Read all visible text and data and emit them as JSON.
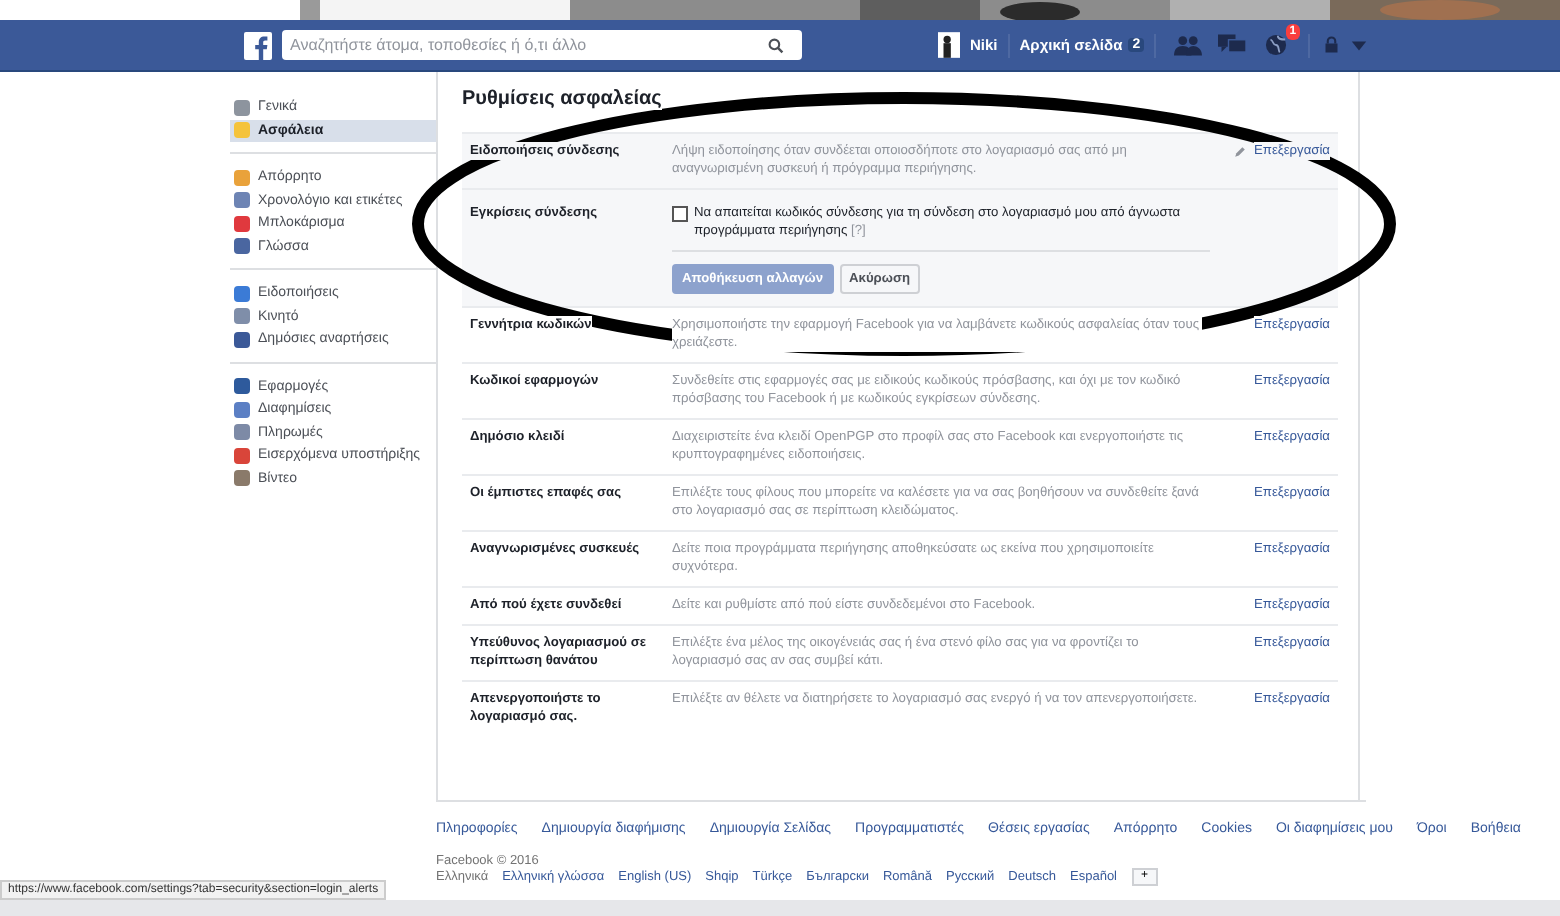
{
  "topbar": {
    "search": {
      "placeholder": "Αναζητήστε άτομα, τοποθεσίες ή ό,τι άλλο"
    },
    "user": "Niki",
    "home": {
      "label": "Αρχική σελίδα",
      "count": "2"
    },
    "notifications_badge": "1"
  },
  "sidebar": {
    "groups": [
      [
        {
          "label": "Γενικά",
          "color": "#8d949e",
          "selected": false
        },
        {
          "label": "Ασφάλεια",
          "color": "#f5c33b",
          "selected": true
        }
      ],
      [
        {
          "label": "Απόρρητο",
          "color": "#e9a23b",
          "selected": false
        },
        {
          "label": "Χρονολόγιο και ετικέτες",
          "color": "#6d84b4",
          "selected": false
        },
        {
          "label": "Μπλοκάρισμα",
          "color": "#e0393e",
          "selected": false
        },
        {
          "label": "Γλώσσα",
          "color": "#4a66a0",
          "selected": false
        }
      ],
      [
        {
          "label": "Ειδοποιήσεις",
          "color": "#3b7bd6",
          "selected": false
        },
        {
          "label": "Κινητό",
          "color": "#7f8ea9",
          "selected": false
        },
        {
          "label": "Δημόσιες αναρτήσεις",
          "color": "#3b5998",
          "selected": false
        }
      ],
      [
        {
          "label": "Εφαρμογές",
          "color": "#2e5a9c",
          "selected": false
        },
        {
          "label": "Διαφημίσεις",
          "color": "#5b7fc4",
          "selected": false
        },
        {
          "label": "Πληρωμές",
          "color": "#7d8aa6",
          "selected": false
        },
        {
          "label": "Εισερχόμενα υποστήριξης",
          "color": "#d9453a",
          "selected": false
        },
        {
          "label": "Βίντεο",
          "color": "#8a7a6a",
          "selected": false
        }
      ]
    ]
  },
  "settings": {
    "title": "Ρυθμίσεις ασφαλείας",
    "rows": [
      {
        "kind": "summary",
        "label": "Ειδοποιήσεις σύνδεσης",
        "description": "Λήψη ειδοποίησης όταν συνδέεται οποιοσδήποτε στο λογαριασμό σας από μη αναγνωρισμένη συσκευή ή πρόγραμμα περιήγησης.",
        "action": "Επεξεργασία",
        "hovered": true
      },
      {
        "kind": "editor",
        "label": "Εγκρίσεις σύνδεσης",
        "option": "Να απαιτείται κωδικός σύνδεσης για τη σύνδεση στο λογαριασμό μου από άγνωστα προγράμματα περιήγησης",
        "help": "[?]",
        "checked": false,
        "buttons": [
          "Αποθήκευση αλλαγών",
          "Ακύρωση"
        ]
      },
      {
        "kind": "summary",
        "label": "Γεννήτρια κωδικών",
        "description": "Χρησιμοποιήστε την εφαρμογή Facebook για να λαμβάνετε κωδικούς ασφαλείας όταν τους χρειάζεστε.",
        "action": "Επεξεργασία",
        "hovered": false
      },
      {
        "kind": "summary",
        "label": "Κωδικοί εφαρμογών",
        "description": "Συνδεθείτε στις εφαρμογές σας με ειδικούς κωδικούς πρόσβασης, και όχι με τον κωδικό πρόσβασης του Facebook ή με κωδικούς εγκρίσεων σύνδεσης.",
        "action": "Επεξεργασία",
        "hovered": false
      },
      {
        "kind": "summary",
        "label": "Δημόσιο κλειδί",
        "description": "Διαχειριστείτε ένα κλειδί OpenPGP στο προφίλ σας στο Facebook και ενεργοποιήστε τις κρυπτογραφημένες ειδοποιήσεις.",
        "action": "Επεξεργασία",
        "hovered": false
      },
      {
        "kind": "summary",
        "label": "Οι έμπιστες επαφές σας",
        "description": "Επιλέξτε τους φίλους που μπορείτε να καλέσετε για να σας βοηθήσουν να συνδεθείτε ξανά στο λογαριασμό σας σε περίπτωση κλειδώματος.",
        "action": "Επεξεργασία",
        "hovered": false
      },
      {
        "kind": "summary",
        "label": "Αναγνωρισμένες συσκευές",
        "description": "Δείτε ποια προγράμματα περιήγησης αποθηκεύσατε ως εκείνα που χρησιμοποιείτε συχνότερα.",
        "action": "Επεξεργασία",
        "hovered": false
      },
      {
        "kind": "summary",
        "label": "Από πού έχετε συνδεθεί",
        "description": "Δείτε και ρυθμίστε από πού είστε συνδεδεμένοι στο Facebook.",
        "action": "Επεξεργασία",
        "hovered": false
      },
      {
        "kind": "summary",
        "label": "Υπεύθυνος λογαριασμού σε περίπτωση θανάτου",
        "description": "Επιλέξτε ένα μέλος της οικογένειάς σας ή ένα στενό φίλο σας για να φροντίζει το λογαριασμό σας αν σας συμβεί κάτι.",
        "action": "Επεξεργασία",
        "hovered": false
      },
      {
        "kind": "summary",
        "label": "Απενεργοποιήστε το λογαριασμό σας.",
        "description": "Επιλέξτε αν θέλετε να διατηρήσετε το λογαριασμό σας ενεργό ή να τον απενεργοποιήσετε.",
        "action": "Επεξεργασία",
        "hovered": false
      }
    ]
  },
  "footer": {
    "links": [
      "Πληροφορίες",
      "Δημιουργία διαφήμισης",
      "Δημιουργία Σελίδας",
      "Προγραμματιστές",
      "Θέσεις εργασίας",
      "Απόρρητο",
      "Cookies",
      "Οι διαφημίσεις μου",
      "Όροι",
      "Βοήθεια"
    ],
    "copyright": "Facebook © 2016",
    "languages": [
      "Ελληνικά",
      "Ελληνική γλώσσα",
      "English (US)",
      "Shqip",
      "Türkçe",
      "Български",
      "Română",
      "Русский",
      "Deutsch",
      "Español"
    ],
    "more": "+"
  },
  "status_url": "https://www.facebook.com/settings?tab=security&section=login_alerts"
}
